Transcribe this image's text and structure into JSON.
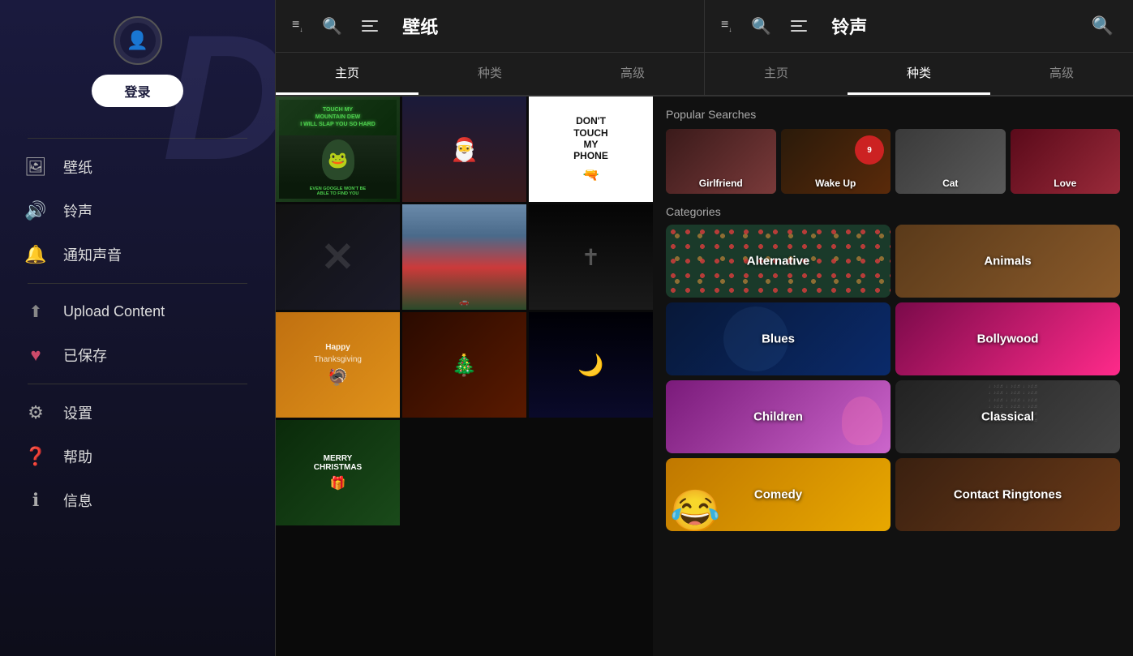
{
  "sidebar": {
    "logo": "D",
    "login_label": "登录",
    "items": [
      {
        "id": "wallpaper",
        "icon": "🖼",
        "label": "壁纸"
      },
      {
        "id": "ringtone",
        "icon": "🔊",
        "label": "铃声"
      },
      {
        "id": "notification",
        "icon": "🔔",
        "label": "通知声音"
      },
      {
        "id": "upload",
        "icon": "⬆",
        "label": "Upload Content"
      },
      {
        "id": "saved",
        "icon": "♥",
        "label": "已保存"
      },
      {
        "id": "settings",
        "icon": "⚙",
        "label": "设置"
      },
      {
        "id": "help",
        "icon": "❓",
        "label": "帮助"
      },
      {
        "id": "info",
        "icon": "ℹ",
        "label": "信息"
      }
    ]
  },
  "topbar": {
    "wallpaper_title": "壁纸",
    "ringtone_title": "铃声",
    "advanced_label": "高级"
  },
  "tabs": {
    "wallpaper": [
      {
        "id": "home",
        "label": "主页",
        "active": true
      },
      {
        "id": "category",
        "label": "种类",
        "active": false
      },
      {
        "id": "advanced",
        "label": "高级",
        "active": false
      }
    ],
    "ringtone": [
      {
        "id": "home",
        "label": "主页",
        "active": false
      },
      {
        "id": "category",
        "label": "种类",
        "active": true
      },
      {
        "id": "advanced",
        "label": "高级",
        "active": false
      }
    ]
  },
  "wallpaper_grid": [
    {
      "id": "wp1",
      "text": "TOUCH MY MOUNTAIN DEW I WILL SLAP YOU SO HARD EVEN GOOGLE WON'T BE ABLE TO FIND YOU",
      "style": "wp-baby-yoda-dew"
    },
    {
      "id": "wp2",
      "text": "",
      "style": "wp-baby-yoda-santa"
    },
    {
      "id": "wp3",
      "text": "DON'T TOUCH MY PHONE",
      "style": "wp-dont-touch"
    },
    {
      "id": "wp4",
      "text": "",
      "style": "wp-twitter-x-1"
    },
    {
      "id": "wp5",
      "text": "",
      "style": "wp-snow-truck"
    },
    {
      "id": "wp6",
      "text": "",
      "style": "wp-jesus"
    },
    {
      "id": "wp7",
      "text": "",
      "style": "wp-thanksgiving"
    },
    {
      "id": "wp8",
      "text": "",
      "style": "wp-christmas-ornament"
    },
    {
      "id": "wp9",
      "text": "",
      "style": "wp-moon"
    },
    {
      "id": "wp10",
      "text": "MERRY CHRISTMAS",
      "style": "wp-merry-christmas"
    }
  ],
  "popular_searches": {
    "title": "Popular Searches",
    "items": [
      {
        "id": "girlfriend",
        "label": "Girlfriend",
        "style": "search-girlfriend"
      },
      {
        "id": "wakeup",
        "label": "Wake Up",
        "style": "search-wakeup"
      },
      {
        "id": "cat",
        "label": "Cat",
        "style": "search-cat"
      },
      {
        "id": "love",
        "label": "Love",
        "style": "search-love"
      }
    ]
  },
  "categories": {
    "title": "Categories",
    "items": [
      {
        "id": "alternative",
        "label": "Alternative",
        "style": "cat-alternative"
      },
      {
        "id": "animals",
        "label": "Animals",
        "style": "cat-animals"
      },
      {
        "id": "blues",
        "label": "Blues",
        "style": "cat-blues"
      },
      {
        "id": "bollywood",
        "label": "Bollywood",
        "style": "cat-bollywood"
      },
      {
        "id": "children",
        "label": "Children",
        "style": "cat-children"
      },
      {
        "id": "classical",
        "label": "Classical",
        "style": "cat-classical"
      },
      {
        "id": "comedy",
        "label": "Comedy",
        "style": "cat-comedy"
      },
      {
        "id": "contact_ringtones",
        "label": "Contact Ringtones",
        "style": "cat-contact"
      }
    ]
  }
}
